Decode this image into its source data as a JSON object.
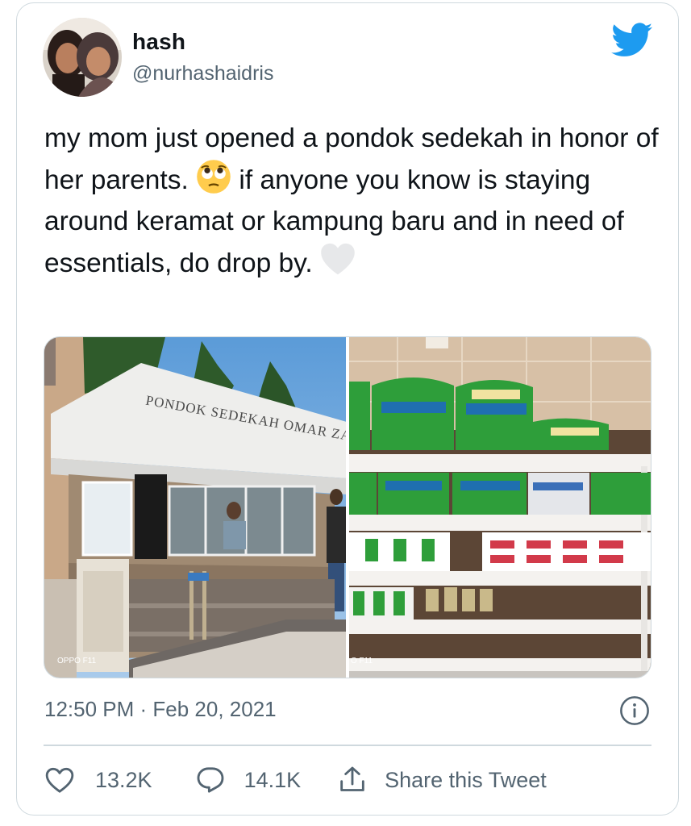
{
  "author": {
    "display_name": "hash",
    "handle": "@nurhashaidris"
  },
  "tweet": {
    "text_part1": "my mom just opened a pondok sedekah in honor of her parents.",
    "emoji_1": "pleading-face",
    "text_part2": "if anyone you know is staying around keramat or kampung baru and in need of essentials, do drop by.",
    "emoji_2": "white-heart"
  },
  "media": {
    "photo_1": {
      "sign_text": "PONDOK SEDEKAH OMAR ZABEDAH",
      "watermark": "OPPO F11"
    },
    "photo_2": {
      "watermark": "O F11"
    }
  },
  "timestamp": "12:50 PM · Feb 20, 2021",
  "actions": {
    "like_count": "13.2K",
    "reply_count": "14.1K",
    "share_label": "Share this Tweet"
  },
  "colors": {
    "twitter_blue": "#1d9bf0",
    "secondary_text": "#536471",
    "border": "#cfd9de"
  }
}
